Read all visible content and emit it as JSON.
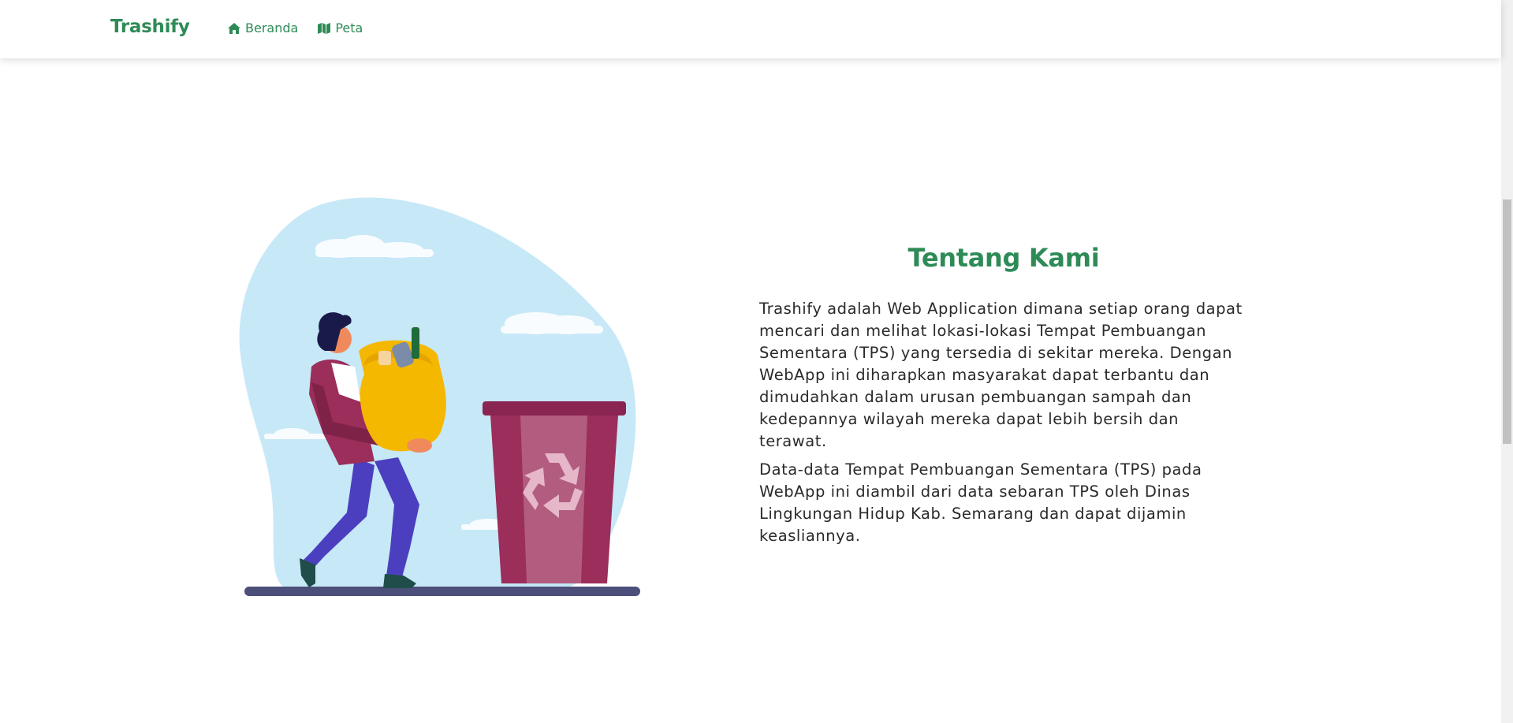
{
  "navbar": {
    "brand": "Trashify",
    "links": [
      {
        "label": "Beranda",
        "icon": "home-icon"
      },
      {
        "label": "Peta",
        "icon": "map-icon"
      }
    ]
  },
  "about": {
    "title": "Tentang Kami",
    "paragraphs": [
      "Trashify adalah Web Application dimana setiap orang dapat mencari dan melihat lokasi-lokasi Tempat Pembuangan Sementara (TPS) yang tersedia di sekitar mereka. Dengan WebApp ini diharapkan masyarakat dapat terbantu dan dimudahkan dalam urusan pembuangan sampah dan kedepannya wilayah mereka dapat lebih bersih dan terawat.",
      "Data-data Tempat Pembuangan Sementara (TPS) pada WebApp ini diambil dari data sebaran TPS oleh Dinas Lingkungan Hidup Kab. Semarang dan dapat dijamin keasliannya."
    ]
  },
  "colors": {
    "brand": "#2e8b57",
    "blob": "#c7e8f7",
    "bin": "#9b2e5a",
    "bag": "#f5b800"
  }
}
